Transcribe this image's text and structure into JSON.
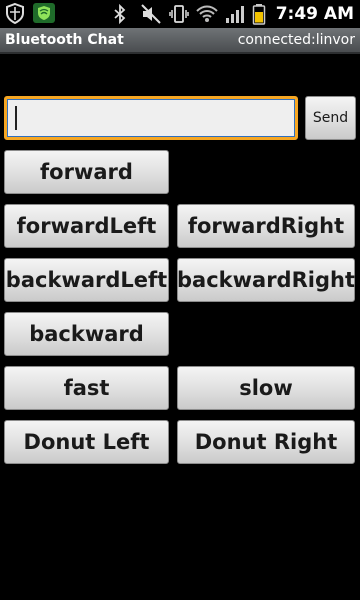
{
  "status_bar": {
    "time": "7:49 AM",
    "icons": [
      "shield-icon",
      "antivirus-icon",
      "bluetooth-icon",
      "mute-icon",
      "vibrate-icon",
      "wifi-icon",
      "signal-icon",
      "battery-icon"
    ],
    "battery_color": "#f2c200"
  },
  "title_bar": {
    "app_title": "Bluetooth Chat",
    "connection_status": "connected:linvor"
  },
  "chat": {
    "input_value": "",
    "send_label": "Send"
  },
  "controls": {
    "forward": "forward",
    "forward_left": "forwardLeft",
    "forward_right": "forwardRight",
    "backward_left": "backwardLeft",
    "backward_right": "backwardRight",
    "backward": "backward",
    "fast": "fast",
    "slow": "slow",
    "donut_left": "Donut Left",
    "donut_right": "Donut Right"
  },
  "colors": {
    "focus_outline": "#f5a623",
    "titlebar": "#5c6063"
  }
}
